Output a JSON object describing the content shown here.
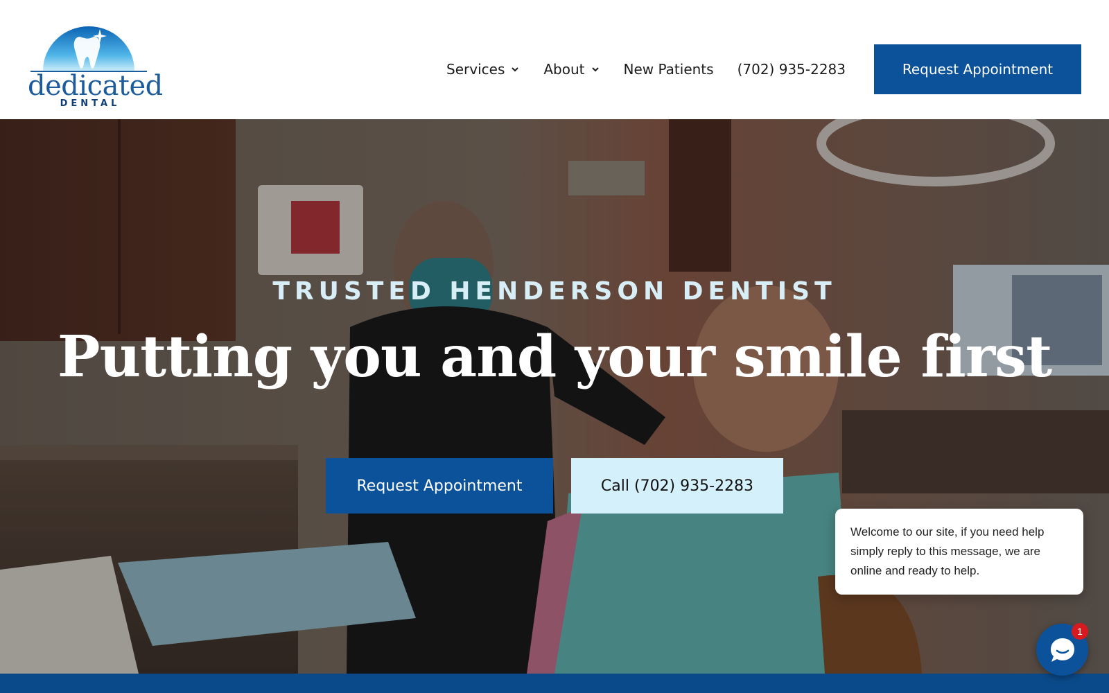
{
  "brand": {
    "name": "dedicated",
    "sub": "DENTAL",
    "colors": {
      "primary": "#0b529b",
      "light": "#d4f0fa",
      "logo_blue": "#1c5c9c"
    }
  },
  "nav": {
    "items": [
      {
        "label": "Services",
        "has_dropdown": true,
        "icon": "chevron-down-icon"
      },
      {
        "label": "About",
        "has_dropdown": true,
        "icon": "chevron-down-icon"
      },
      {
        "label": "New Patients",
        "has_dropdown": false
      },
      {
        "label": "(702) 935-2283",
        "has_dropdown": false
      }
    ],
    "cta": "Request Appointment"
  },
  "hero": {
    "eyebrow": "TRUSTED HENDERSON DENTIST",
    "headline": "Putting you and your smile first",
    "buttons": [
      {
        "label": "Request Appointment",
        "style": "primary"
      },
      {
        "label": "Call (702) 935-2283",
        "style": "secondary"
      }
    ]
  },
  "chat": {
    "message": "Welcome to our site, if you need help simply reply to this message, we are online and ready to help.",
    "unread_count": "1",
    "icon": "chat-bubble-icon"
  }
}
